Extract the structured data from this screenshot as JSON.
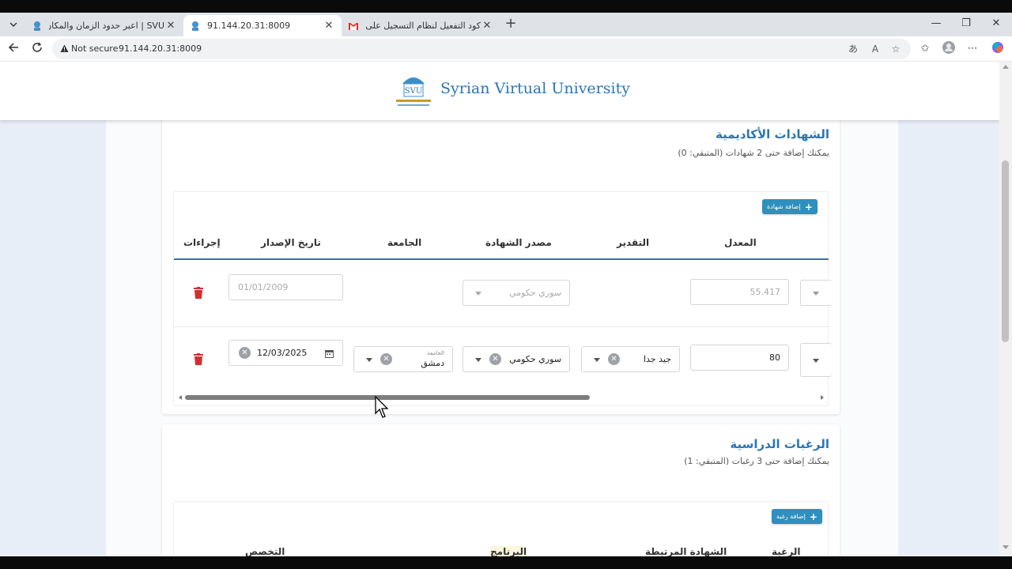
{
  "browser": {
    "tabs": [
      {
        "title": "SVU | اعبر حدود الزمان والمكان",
        "active": false
      },
      {
        "title": "91.144.20.31:8009",
        "active": true
      },
      {
        "title": "كود التفعيل لنظام التسجيل على الـ",
        "active": false
      }
    ],
    "security_label": "Not secure",
    "url": "91.144.20.31:8009"
  },
  "header": {
    "brand_name": "Syrian Virtual University",
    "logo_text": "SVU"
  },
  "certificates": {
    "title": "الشهادات الأكاديمية",
    "subtitle": "يمكنك إضافة حتى 2 شهادات (المتبقي: 0)",
    "add_button": "إضافة شهادة",
    "columns": [
      "المعدل",
      "التقدير",
      "مصدر الشهادة",
      "الجامعة",
      "تاريخ الإصدار",
      "إجراءات"
    ],
    "rows": [
      {
        "average": "55.417",
        "grade": "",
        "source": "سوري حكومي",
        "university": "",
        "university_label": "",
        "date": "01/01/2009"
      },
      {
        "average": "80",
        "grade": "جيد جدا",
        "source": "سوري حكومي",
        "university": "دمشق",
        "university_label": "الجامعة",
        "date": "12/03/2025"
      }
    ]
  },
  "preferences": {
    "title": "الرغبات الدراسية",
    "subtitle": "يمكنك إضافة حتى 3 رغبات (المتبقي: 1)",
    "add_button": "إضافة رغبة",
    "columns": [
      "الرغبة",
      "الشهادة المرتبطة",
      "البرنامج",
      "التخصص"
    ]
  },
  "colors": {
    "accent": "#2a76b3",
    "button": "#2f8fbf",
    "delete": "#d32f2f"
  }
}
